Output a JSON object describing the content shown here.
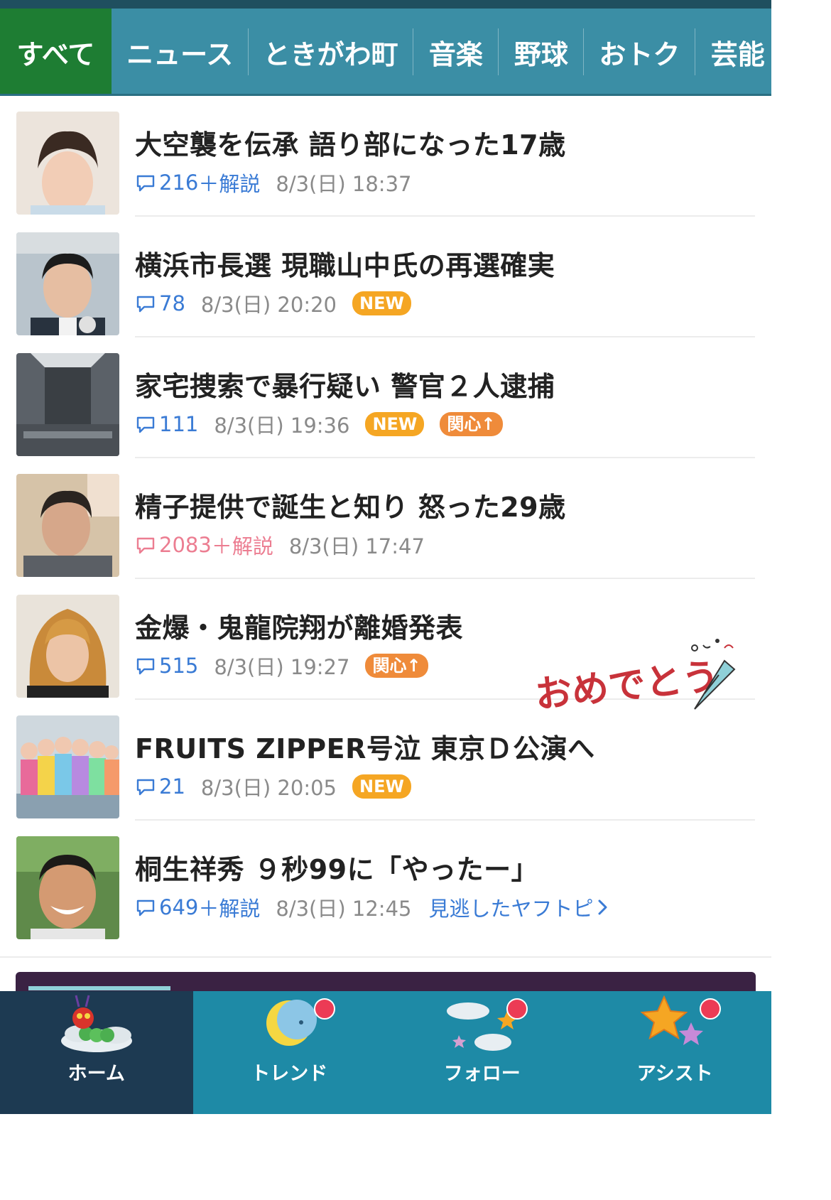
{
  "tabs": [
    {
      "label": "すべて",
      "active": true
    },
    {
      "label": "ニュース",
      "active": false
    },
    {
      "label": "ときがわ町",
      "active": false
    },
    {
      "label": "音楽",
      "active": false
    },
    {
      "label": "野球",
      "active": false
    },
    {
      "label": "おトク",
      "active": false
    },
    {
      "label": "芸能",
      "active": false
    }
  ],
  "news": [
    {
      "title": "大空襲を伝承 語り部になった17歳",
      "comments": "216",
      "extra": "＋解説",
      "datetime": "8/3(日) 18:37"
    },
    {
      "title": "横浜市長選 現職山中氏の再選確実",
      "comments": "78",
      "datetime": "8/3(日) 20:20",
      "badge_new": "NEW"
    },
    {
      "title": "家宅捜索で暴行疑い 警官２人逮捕",
      "comments": "111",
      "datetime": "8/3(日) 19:36",
      "badge_new": "NEW",
      "badge_interest": "関心↑"
    },
    {
      "title": "精子提供で誕生と知り 怒った29歳",
      "comments": "2083",
      "extra": "＋解説",
      "datetime": "8/3(日) 17:47"
    },
    {
      "title": "金爆・鬼龍院翔が離婚発表",
      "comments": "515",
      "datetime": "8/3(日) 19:27",
      "badge_interest": "関心↑"
    },
    {
      "title": "FRUITS ZIPPER号泣 東京Ｄ公演へ",
      "comments": "21",
      "datetime": "8/3(日) 20:05",
      "badge_new": "NEW"
    },
    {
      "title": "桐生祥秀 ９秒99に「やったー」",
      "comments": "649",
      "extra": "＋解説",
      "datetime": "8/3(日) 12:45",
      "missed_link": "見逃したヤフトピ"
    }
  ],
  "celebration_text": "おめでとう",
  "bottom_nav": [
    {
      "label": "ホーム",
      "icon": "caterpillar-icon"
    },
    {
      "label": "トレンド",
      "icon": "moon-icon"
    },
    {
      "label": "フォロー",
      "icon": "cloud-star-icon"
    },
    {
      "label": "アシスト",
      "icon": "star-icon"
    }
  ],
  "colors": {
    "tab_bar": "#3b8ea5",
    "active_tab": "#1e7d33",
    "comment_blue": "#3a7bd5",
    "comment_hot": "#ec7d91",
    "new_badge": "#f5a623",
    "interest_badge": "#ef8b3a",
    "nav_home": "#1d3a52",
    "nav_other": "#1e8aa6",
    "notification_dot": "#ec3b55"
  }
}
